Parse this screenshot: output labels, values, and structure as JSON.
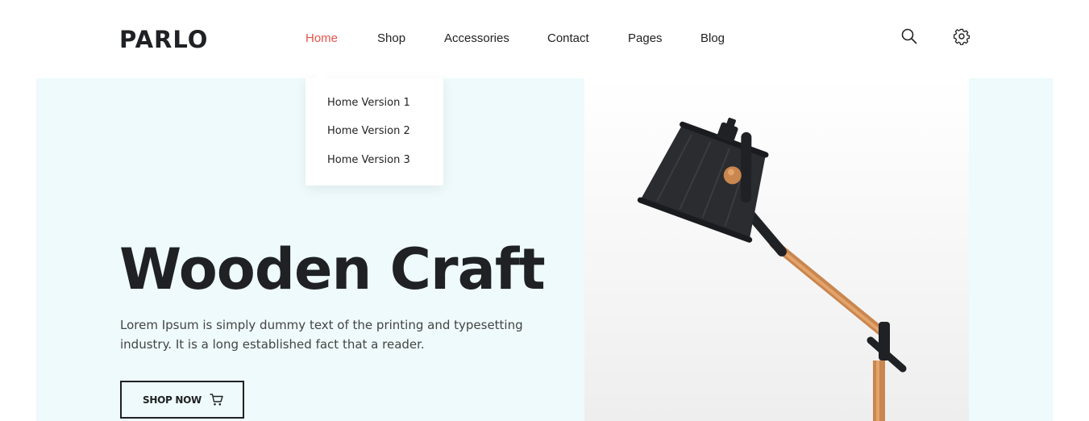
{
  "brand": {
    "logo": "PARLO"
  },
  "nav": {
    "items": [
      {
        "label": "Home",
        "active": true
      },
      {
        "label": "Shop"
      },
      {
        "label": "Accessories"
      },
      {
        "label": "Contact"
      },
      {
        "label": "Pages"
      },
      {
        "label": "Blog"
      }
    ]
  },
  "header_icons": [
    "search-icon",
    "gear-icon"
  ],
  "dropdown": {
    "items": [
      "Home Version 1",
      "Home Version 2",
      "Home Version 3"
    ]
  },
  "hero": {
    "title": "Wooden Craft",
    "text": "Lorem Ipsum is simply dummy text of the printing and typesetting industry. It is a long established fact that a reader.",
    "button_label": "SHOP NOW",
    "button_icon": "cart-icon"
  },
  "colors": {
    "accent": "#e5534b",
    "text_dark": "#1f2124",
    "hero_background": "#eefafb"
  }
}
